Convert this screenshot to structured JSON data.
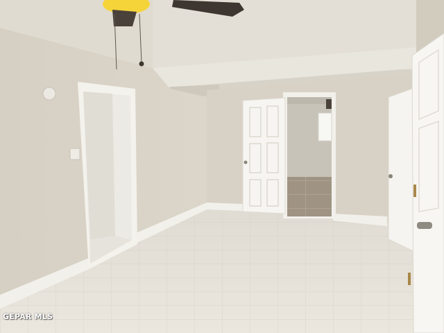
{
  "photo": {
    "watermark": "GEPAR MLS",
    "colors": {
      "wall": "#d9d3c7",
      "wall_shadow": "#cfc9bc",
      "ceiling": "#e6e2d9",
      "floor_tile": "#e8e4dc",
      "door": "#f6f5f1",
      "fan_bulb": "#f5d43a",
      "fan_blade": "#3e3630"
    }
  }
}
